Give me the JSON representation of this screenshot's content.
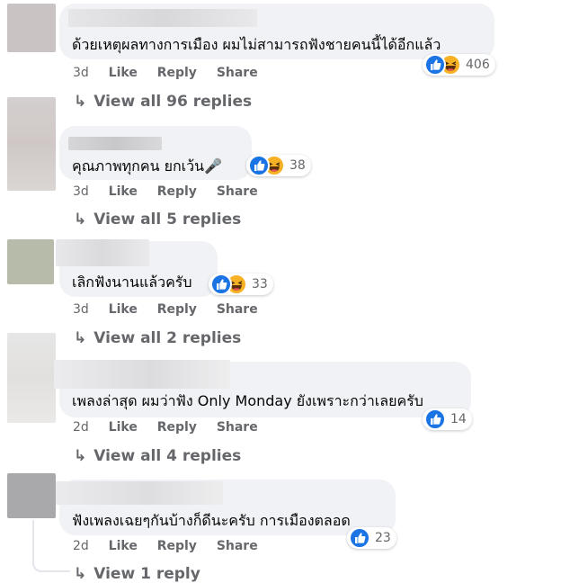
{
  "comments": [
    {
      "text": "ด้วยเหตุผลทางการเมือง ผมไม่สามารถฟังชายคนนี้ได้อีกแล้ว",
      "reactions": [
        "like",
        "haha"
      ],
      "reaction_count": "406",
      "time": "3d",
      "like_label": "Like",
      "reply_label": "Reply",
      "share_label": "Share",
      "replies_label": "View all 96 replies"
    },
    {
      "text": "คุณภาพทุกคน ยกเว้น🎤",
      "reactions": [
        "like",
        "haha"
      ],
      "reaction_count": "38",
      "time": "3d",
      "like_label": "Like",
      "reply_label": "Reply",
      "share_label": "Share",
      "replies_label": "View all 5 replies"
    },
    {
      "text": "เลิกฟังนานแล้วครับ",
      "reactions": [
        "like",
        "haha"
      ],
      "reaction_count": "33",
      "time": "3d",
      "like_label": "Like",
      "reply_label": "Reply",
      "share_label": "Share",
      "replies_label": "View all 2 replies"
    },
    {
      "text": "เพลงล่าสุด ผมว่าฟัง Only Monday ยังเพราะกว่าเลยครับ",
      "reactions": [
        "like"
      ],
      "reaction_count": "14",
      "time": "2d",
      "like_label": "Like",
      "reply_label": "Reply",
      "share_label": "Share",
      "replies_label": "View all 4 replies"
    },
    {
      "text": "ฟังเพลงเฉยๆกันบ้างก็ดีนะครับ การเมืองตลอด",
      "reactions": [
        "like"
      ],
      "reaction_count": "23",
      "time": "2d",
      "like_label": "Like",
      "reply_label": "Reply",
      "share_label": "Share",
      "replies_label": "View 1 reply"
    }
  ],
  "icons": {
    "reply_arrow": "↳",
    "like": "thumbs-up-icon",
    "haha": "laughing-face-icon"
  },
  "colors": {
    "bubble": "#f0f2f5",
    "like_blue": "#1b74e4",
    "haha_yellow": "#f7b125",
    "secondary_text": "#65676b"
  }
}
